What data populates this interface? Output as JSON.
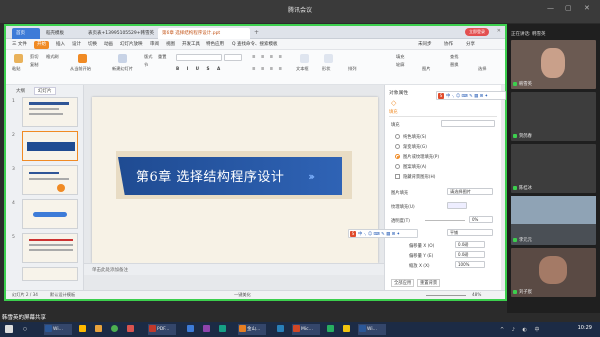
{
  "meeting_app": {
    "title": "腾讯会议",
    "share_label": "韩雪英的屏幕共享",
    "speaking": "正在讲话: 韩雪英",
    "participants": [
      {
        "name": "韩雪英"
      },
      {
        "name": "贺鸽春"
      },
      {
        "name": "陈桂冰"
      },
      {
        "name": "李元元"
      },
      {
        "name": "刘子宸"
      }
    ]
  },
  "wps": {
    "tabs": [
      {
        "label": "首页"
      },
      {
        "label": "稻壳模板"
      },
      {
        "label": "表页表+13995105529+韩雪英"
      },
      {
        "label": "第6章 选择结构程序设计.ppt"
      }
    ],
    "login_label": "立即登录",
    "menus": [
      "三 文件",
      "开始",
      "插入",
      "设计",
      "切换",
      "动画",
      "幻灯片放映",
      "审阅",
      "视图",
      "开发工具",
      "特色应用",
      "Q 查找命令、搜索模板"
    ],
    "menu_active": "开始",
    "right_menus": [
      "未同步",
      "协作",
      "分享"
    ],
    "ribbon": {
      "paste": "粘贴",
      "cut": "剪切",
      "copy": "复制",
      "format_painter": "格式刷",
      "from_current": "从当前开始",
      "new_slide": "新建幻灯片",
      "layout": "版式",
      "section": "节",
      "reset": "重置",
      "textbox": "文本框",
      "shape": "形状",
      "arrange": "排列",
      "find": "查找",
      "replace": "替换",
      "select": "选择",
      "fill": "填充",
      "outline": "轮廓",
      "picture": "图片"
    },
    "slide_panel": {
      "tab_outline": "大纲",
      "tab_slides": "幻灯片",
      "thumbnail_numbers": [
        "1",
        "2",
        "3",
        "4",
        "5"
      ]
    },
    "slide": {
      "title": "第6章  选择结构程序设计",
      "chevrons": "›››"
    },
    "notes_placeholder": "单击此处添加备注",
    "properties": {
      "title": "对象属性",
      "fill_tab": "填充",
      "fill_label": "填充",
      "options": [
        {
          "label": "纯色填充(S)",
          "checked": false
        },
        {
          "label": "渐变填充(G)",
          "checked": false
        },
        {
          "label": "图片或纹理填充(P)",
          "checked": true
        },
        {
          "label": "图案填充(A)",
          "checked": false
        }
      ],
      "hide_background": "隐藏背景图形(H)",
      "picture_fill_label": "图片填充",
      "picture_fill_value": "请选择图片",
      "texture_label": "纹理填充(U)",
      "transparency_label": "透明度(T)",
      "transparency_value": "0%",
      "tile_label": "放置方式",
      "tile_value": "平铺",
      "offset_x": "偏移量 X (O)",
      "offset_x_value": "0.0磅",
      "offset_y": "偏移量 Y (E)",
      "offset_y_value": "0.0磅",
      "scale_x": "缩放 X (X)",
      "scale_x_value": "100%",
      "apply_all": "全部应用",
      "reset_bg": "重置背景"
    },
    "status": {
      "slide_count": "幻灯片 2 / 34",
      "theme": "默认设计模板",
      "beautify": "一键美化",
      "zoom": "48%"
    },
    "ime_glyphs": "中 ·, ☺ ⌨ ✎ ▦ ⊞ ✦"
  },
  "taskbar": {
    "items": [
      "Wi...",
      "",
      "",
      "",
      "",
      "PDF...",
      "",
      "",
      "",
      "金山...",
      "",
      "Mic...",
      "",
      "",
      "Wi..."
    ],
    "clock": "10:29"
  },
  "colors": {
    "accent_orange": "#f08a24",
    "share_border": "#3ccf4e",
    "banner_blue": "#1f4b92",
    "taskbar": "#1c2b45"
  }
}
